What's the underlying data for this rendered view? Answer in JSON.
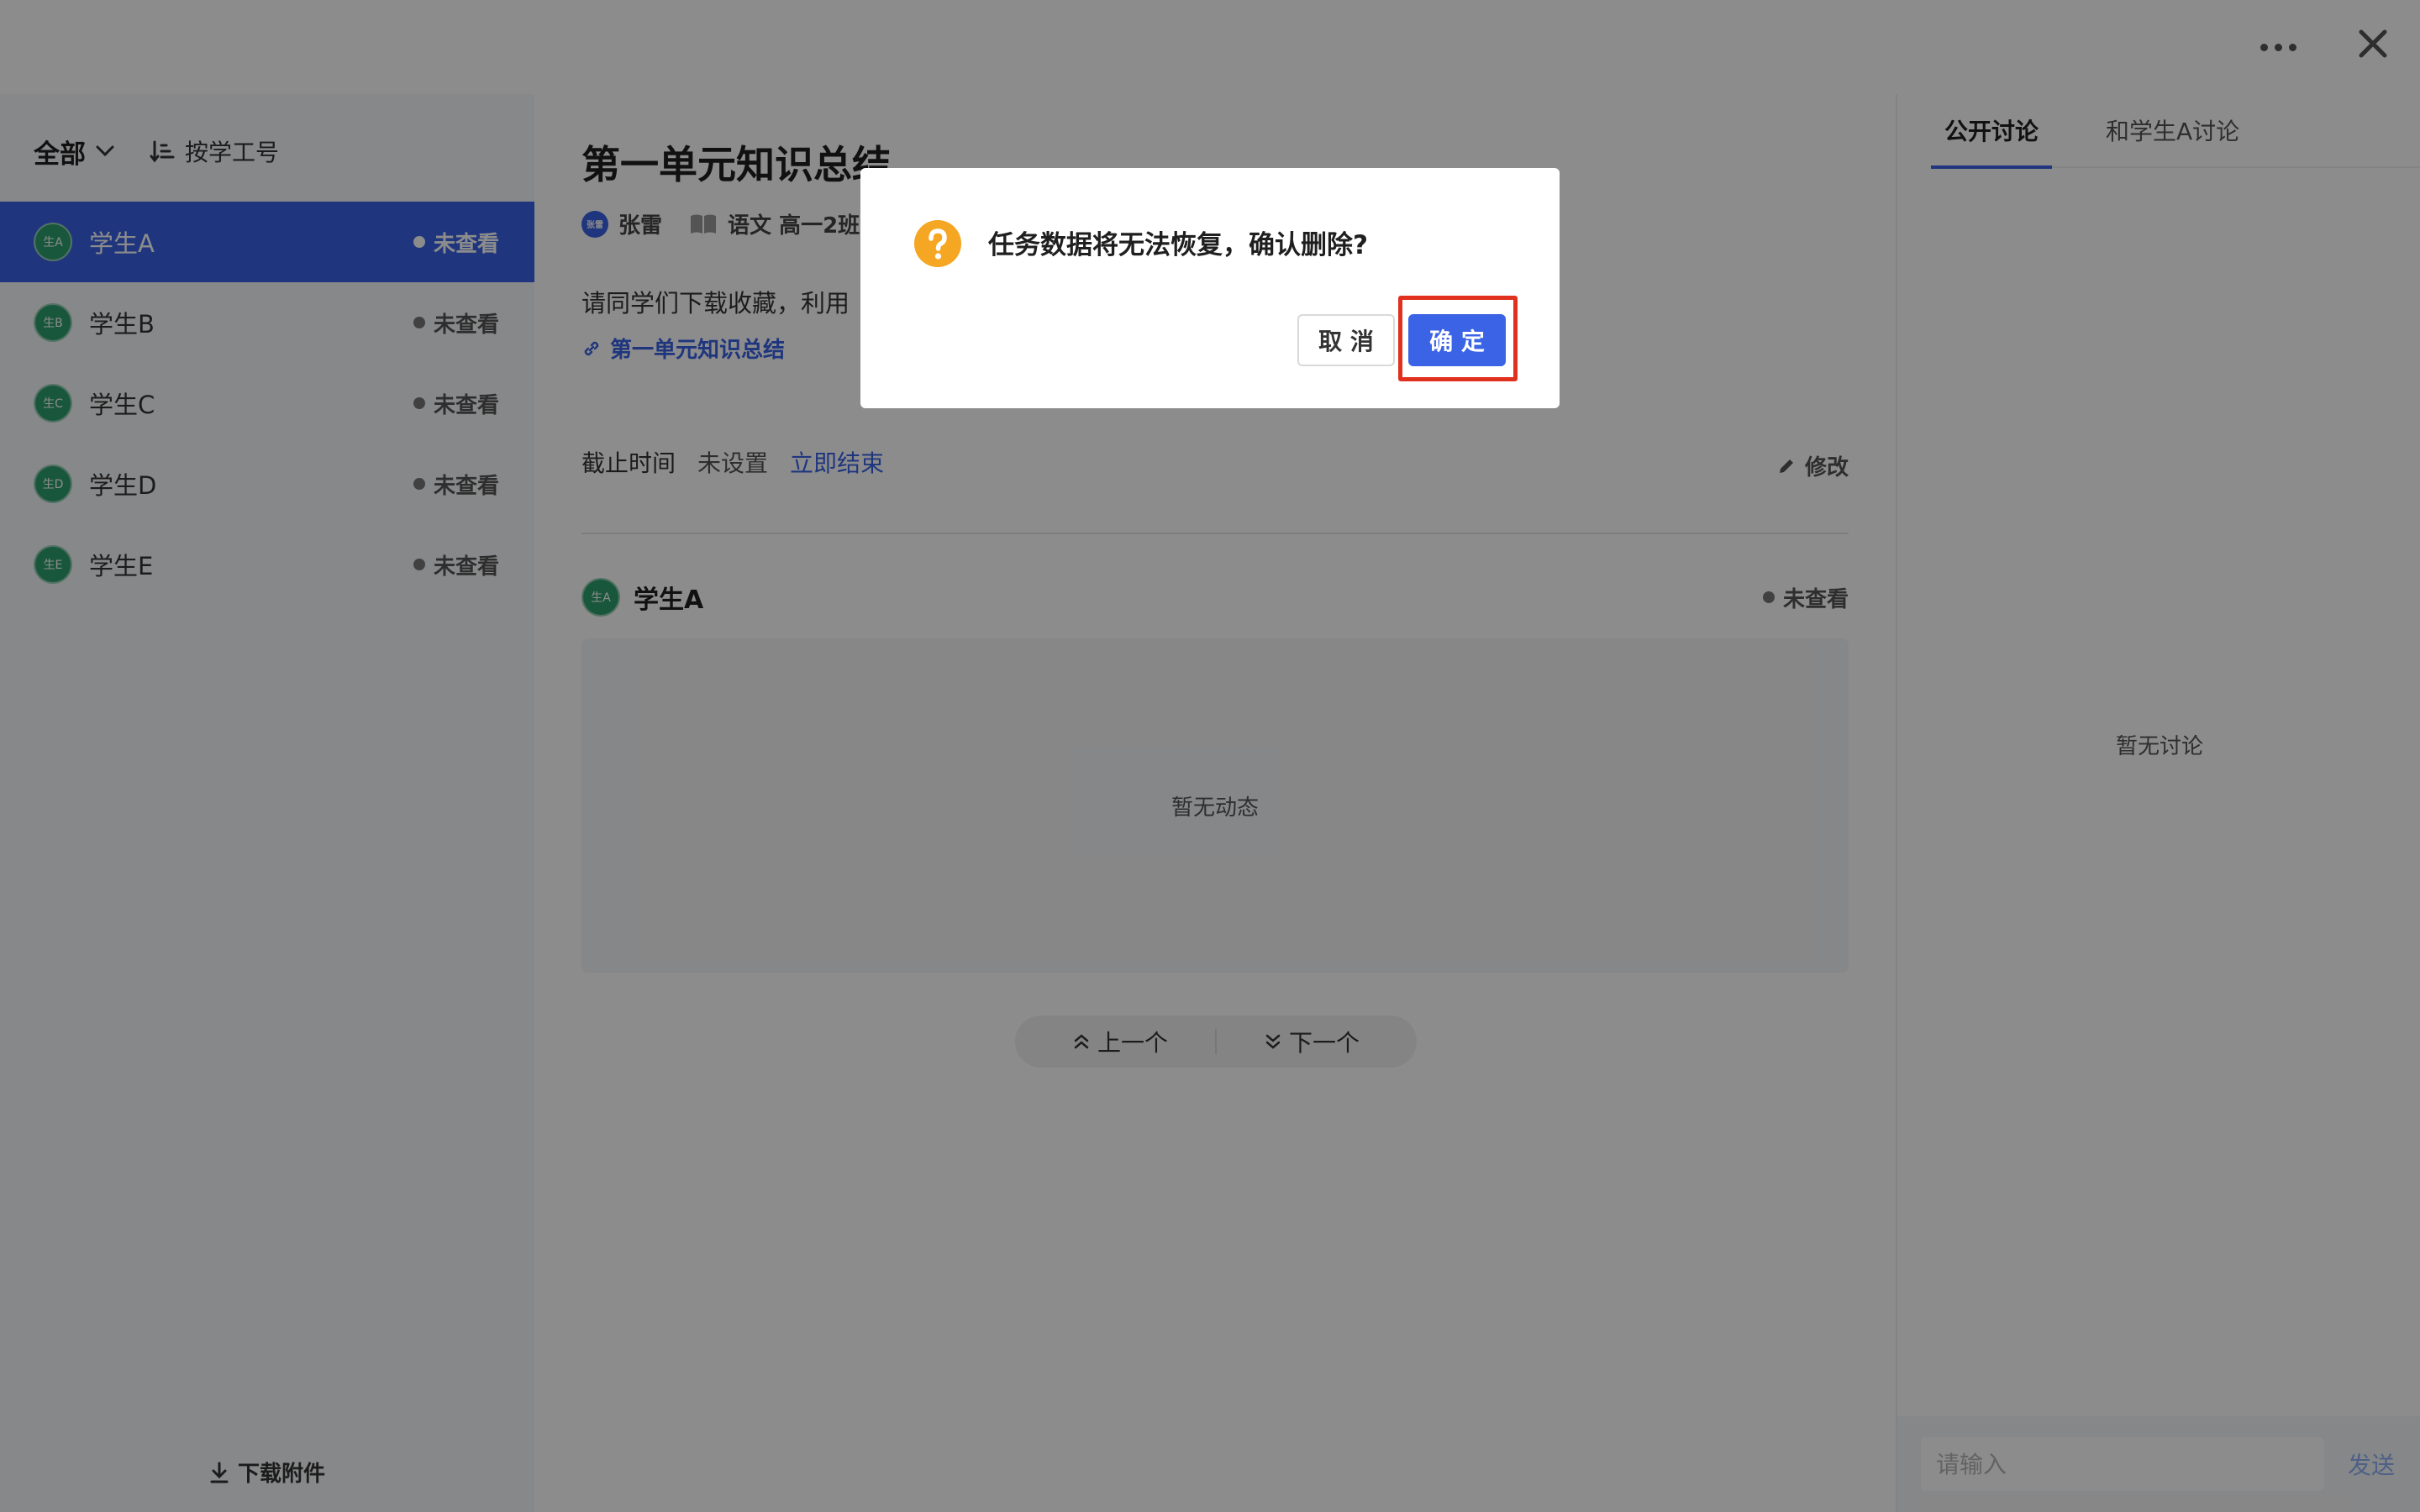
{
  "topbar": {
    "more_icon": "more-horizontal-icon",
    "close_icon": "close-icon"
  },
  "left": {
    "filter_label": "全部",
    "sort_label": "按学工号",
    "students": [
      {
        "avatar": "生A",
        "name": "学生A",
        "status": "未查看",
        "active": true
      },
      {
        "avatar": "生B",
        "name": "学生B",
        "status": "未查看"
      },
      {
        "avatar": "生C",
        "name": "学生C",
        "status": "未查看"
      },
      {
        "avatar": "生D",
        "name": "学生D",
        "status": "未查看"
      },
      {
        "avatar": "生E",
        "name": "学生E",
        "status": "未查看"
      }
    ],
    "download_label": "下载附件"
  },
  "task": {
    "title": "第一单元知识总结",
    "teacher_avatar": "张雷",
    "teacher": "张雷",
    "course": "语文 高一2班",
    "description": "请同学们下载收藏，利用",
    "link_text": "第一单元知识总结",
    "deadline_label": "截止时间",
    "deadline_value": "未设置",
    "end_now": "立即结束",
    "edit_label": "修改"
  },
  "submission": {
    "avatar": "生A",
    "name": "学生A",
    "status": "未查看",
    "empty_text": "暂无动态",
    "prev_label": "上一个",
    "next_label": "下一个"
  },
  "discussion": {
    "tabs": [
      "公开讨论",
      "和学生A讨论"
    ],
    "empty_text": "暂无讨论",
    "input_placeholder": "请输入",
    "send_label": "发送"
  },
  "modal": {
    "message": "任务数据将无法恢复，确认删除?",
    "cancel_label": "取 消",
    "ok_label": "确 定",
    "icon": "question-circle-icon"
  },
  "colors": {
    "primary": "#3a63e6",
    "warning": "#f5a623",
    "highlight": "#e0301e",
    "avatar": "#2e9e6e"
  }
}
